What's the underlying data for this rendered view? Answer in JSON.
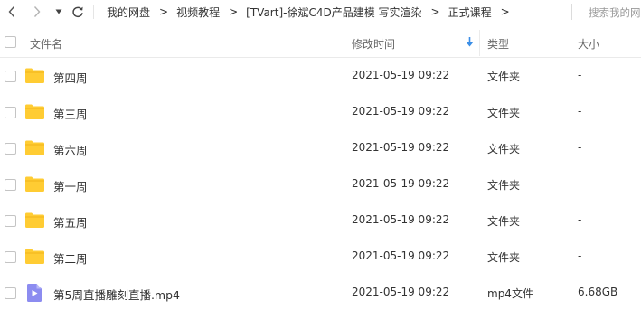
{
  "nav": {
    "back_icon": "chevron-left-icon",
    "forward_icon": "chevron-right-icon",
    "history_icon": "caret-down-icon",
    "refresh_icon": "refresh-icon",
    "breadcrumbs": [
      "我的网盘",
      "视频教程",
      "[TVart]-徐斌C4D产品建模 写实渲染",
      "正式课程"
    ],
    "separator": ">",
    "search_placeholder": "搜索我的网"
  },
  "header": {
    "name": "文件名",
    "modified": "修改时间",
    "type": "类型",
    "size": "大小",
    "sort_icon": "sort-down-arrow-icon",
    "accent_color": "#3a8ee6"
  },
  "files": [
    {
      "name": "第四周",
      "date": "2021-05-19 09:22",
      "type": "文件夹",
      "size": "-",
      "icon": "folder-icon"
    },
    {
      "name": "第三周",
      "date": "2021-05-19 09:22",
      "type": "文件夹",
      "size": "-",
      "icon": "folder-icon"
    },
    {
      "name": "第六周",
      "date": "2021-05-19 09:22",
      "type": "文件夹",
      "size": "-",
      "icon": "folder-icon"
    },
    {
      "name": "第一周",
      "date": "2021-05-19 09:22",
      "type": "文件夹",
      "size": "-",
      "icon": "folder-icon"
    },
    {
      "name": "第五周",
      "date": "2021-05-19 09:22",
      "type": "文件夹",
      "size": "-",
      "icon": "folder-icon"
    },
    {
      "name": "第二周",
      "date": "2021-05-19 09:22",
      "type": "文件夹",
      "size": "-",
      "icon": "folder-icon"
    },
    {
      "name": "第5周直播雕刻直播.mp4",
      "date": "2021-05-19 09:22",
      "type": "mp4文件",
      "size": "6.68GB",
      "icon": "video-file-icon"
    }
  ],
  "colors": {
    "folder": "#ffcc33",
    "video_file": "#8c8cf0"
  }
}
